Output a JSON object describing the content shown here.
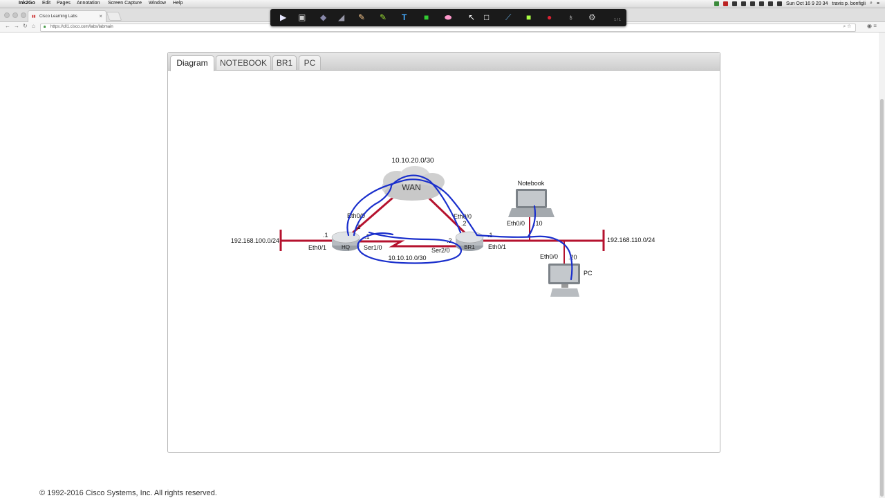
{
  "menubar": {
    "app": "Ink2Go",
    "items": [
      "Edit",
      "Pages",
      "Annotation",
      "Screen Capture",
      "Window",
      "Help"
    ],
    "clock": "Sun Oct 16  9 20 34",
    "user": "travis p. bonfigli"
  },
  "browser": {
    "tab_title": "Cisco Learning Labs",
    "url": "https://cll1.cisco.com/labs/labmain"
  },
  "ink2go": {
    "page_indicator": "1 / 1"
  },
  "panel": {
    "tabs": [
      "Diagram",
      "NOTEBOOK",
      "BR1",
      "PC"
    ]
  },
  "diagram": {
    "wan_label": "WAN",
    "wan_subnet": "10.10.20.0/30",
    "serial_subnet": "10.10.10.0/30",
    "lan_hq": "192.168.100.0/24",
    "lan_br1": "192.168.110.0/24",
    "hq_name": "HQ",
    "br1_name": "BR1",
    "notebook_name": "Notebook",
    "pc_name": "PC",
    "hq_eth00": "Eth0/0",
    "hq_eth01": "Eth0/1",
    "hq_ser": "Ser1/0",
    "br1_eth00": "Eth0/0",
    "br1_eth01": "Eth0/1",
    "br1_ser": "Ser2/0",
    "notebook_eth": "Eth0/0",
    "pc_eth": "Eth0/0",
    "hq_lan_ip": ".1",
    "hq_ser_ip": ".1",
    "hq_wan_ip": ".1",
    "br1_wan_ip": ".2",
    "br1_ser_ip": ".2",
    "br1_lan_ip": ".1",
    "notebook_ip": ".10",
    "pc_ip": ".20"
  },
  "footer": {
    "copyright": "© 1992-2016 Cisco Systems, Inc. All rights reserved."
  },
  "colors": {
    "link": "#b5122e",
    "annotation": "#1a2fcc"
  }
}
